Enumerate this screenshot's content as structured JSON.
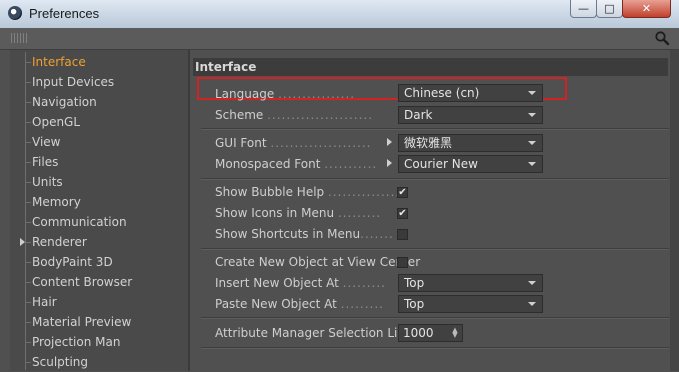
{
  "window": {
    "title": "Preferences",
    "minimize_glyph": "—",
    "maximize_glyph": "□",
    "close_glyph": "✕"
  },
  "sidebar": {
    "items": [
      {
        "label": "Interface",
        "active": true
      },
      {
        "label": "Input Devices"
      },
      {
        "label": "Navigation"
      },
      {
        "label": "OpenGL"
      },
      {
        "label": "View"
      },
      {
        "label": "Files"
      },
      {
        "label": "Units"
      },
      {
        "label": "Memory"
      },
      {
        "label": "Communication"
      },
      {
        "label": "Renderer",
        "expandable": true
      },
      {
        "label": "BodyPaint 3D"
      },
      {
        "label": "Content Browser"
      },
      {
        "label": "Hair"
      },
      {
        "label": "Material Preview"
      },
      {
        "label": "Projection Man"
      },
      {
        "label": "Sculpting"
      }
    ]
  },
  "main": {
    "section_title": "Interface",
    "language": {
      "label": "Language",
      "value": "Chinese (cn)"
    },
    "scheme": {
      "label": "Scheme",
      "value": "Dark"
    },
    "gui_font": {
      "label": "GUI Font",
      "value": "微软雅黑"
    },
    "mono_font": {
      "label": "Monospaced Font",
      "value": "Courier New"
    },
    "show_bubble_help": {
      "label": "Show Bubble Help",
      "checked": true,
      "mark": "✔"
    },
    "show_icons_in_menu": {
      "label": "Show Icons in Menu",
      "checked": true,
      "mark": "✔"
    },
    "show_shortcuts_in_menu": {
      "label": "Show Shortcuts in Menu",
      "checked": false,
      "mark": ""
    },
    "create_new_object_at_view_center": {
      "label": "Create New Object at View Center",
      "checked": false,
      "mark": ""
    },
    "insert_new_object_at": {
      "label": "Insert New Object At",
      "value": "Top"
    },
    "paste_new_object_at": {
      "label": "Paste New Object At",
      "value": "Top"
    },
    "attribute_manager_selection_limit": {
      "label": "Attribute Manager Selection Limit",
      "value": "1000"
    }
  },
  "colors": {
    "active_item": "#f0a030",
    "highlight_box": "#d32222",
    "panel_bg": "#505050"
  }
}
